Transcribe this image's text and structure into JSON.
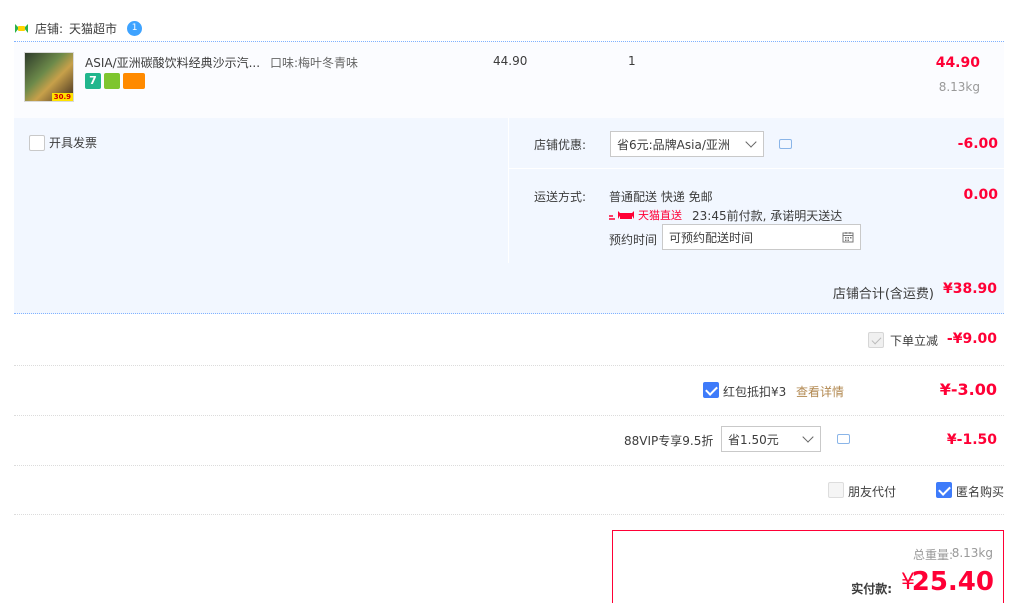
{
  "shop": {
    "label": "店铺:",
    "name": "天猫超市",
    "badge": "1"
  },
  "item": {
    "title": "ASIA/亚洲碳酸饮料经典沙示汽...",
    "sku": "口味:梅叶冬青味",
    "thumb_tag": "30.9",
    "unit_price": "44.90",
    "quantity": "1",
    "line_total": "44.90",
    "weight": "8.13kg",
    "service_icon_a": "7"
  },
  "invoice": {
    "label": "开具发票"
  },
  "shop_discount": {
    "label": "店铺优惠:",
    "selected": "省6元:品牌Asia/亚洲",
    "amount": "-6.00"
  },
  "shipping": {
    "label": "运送方式:",
    "method": "普通配送 快递 免邮",
    "direct_badge": "天猫直送",
    "promise": "23:45前付款, 承诺明天送达",
    "schedule_label": "预约时间",
    "schedule_placeholder": "可预约配送时间",
    "amount": "0.00"
  },
  "shop_total": {
    "label": "店铺合计(含运费)",
    "amount": "¥38.90"
  },
  "order_discount": {
    "label": "下单立减",
    "amount": "-¥9.00"
  },
  "red_packet": {
    "label": "红包抵扣¥3",
    "link": "查看详情",
    "amount": "¥-3.00"
  },
  "vip": {
    "label": "88VIP专享9.5折",
    "selected": "省1.50元",
    "amount": "¥-1.50"
  },
  "options": {
    "friend_pay": "朋友代付",
    "anonymous": "匿名购买"
  },
  "summary": {
    "weight_label": "总重量:",
    "weight": "8.13kg",
    "pay_label": "实付款:",
    "currency": "¥",
    "pay_amount": "25.40"
  },
  "colors": {
    "accent_red": "#ff0036",
    "checkbox_blue": "#3e7bfa",
    "panel_bg": "#f2f7ff"
  }
}
